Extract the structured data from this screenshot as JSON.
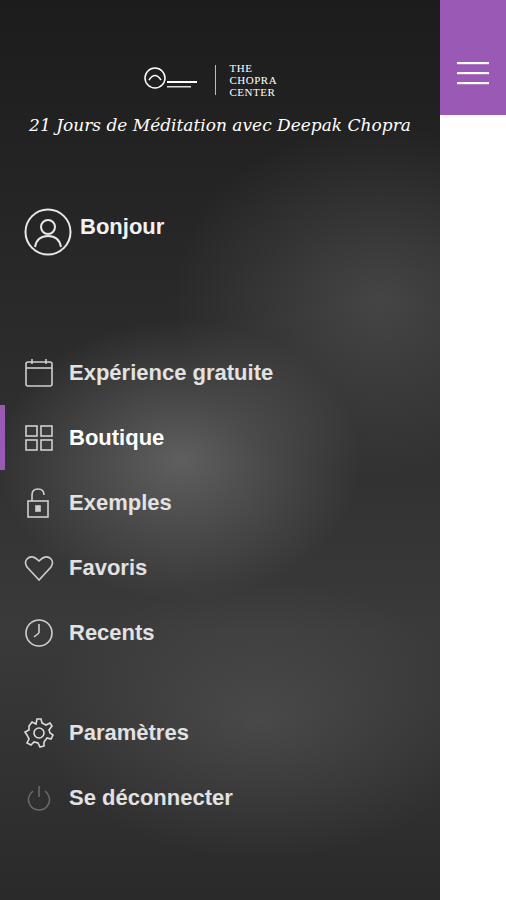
{
  "header": {
    "logo_text": "THE CHOPRA CENTER",
    "title": "21 Jours de Méditation avec Deepak Chopra"
  },
  "user": {
    "greeting": "Bonjour"
  },
  "menu": {
    "items": [
      {
        "label": "Expérience gratuite",
        "selected": false
      },
      {
        "label": "Boutique",
        "selected": true
      },
      {
        "label": "Exemples",
        "selected": false
      },
      {
        "label": "Favoris",
        "selected": false
      },
      {
        "label": "Recents",
        "selected": false
      }
    ]
  },
  "footer": {
    "items": [
      {
        "label": "Paramètres",
        "selected": false
      },
      {
        "label": "Se déconnecter",
        "selected": false
      }
    ]
  }
}
